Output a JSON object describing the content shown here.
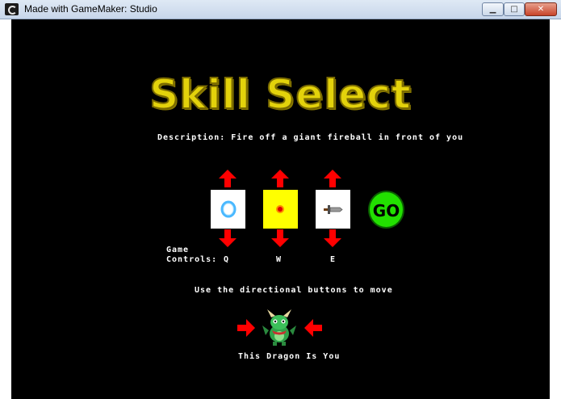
{
  "window": {
    "title": "Made with GameMaker: Studio",
    "minimize_glyph": "▁",
    "maximize_glyph": "□",
    "close_glyph": "✕"
  },
  "game": {
    "title": "Skill Select",
    "description": "Description: Fire off a giant fireball in front of you",
    "controls_label_line1": "Game",
    "controls_label_line2": "Controls:",
    "keys": [
      "Q",
      "W",
      "E"
    ],
    "go_label": "GO",
    "move_hint": "Use the directional buttons to move",
    "dragon_label": "This Dragon Is You"
  },
  "skills": [
    {
      "icon": "ice-ring-icon"
    },
    {
      "icon": "fireball-icon"
    },
    {
      "icon": "sword-icon"
    }
  ],
  "colors": {
    "title": "#e3d20b",
    "arrow": "#ff0000",
    "go": "#22e000",
    "selected_slot": "#ffff00"
  }
}
